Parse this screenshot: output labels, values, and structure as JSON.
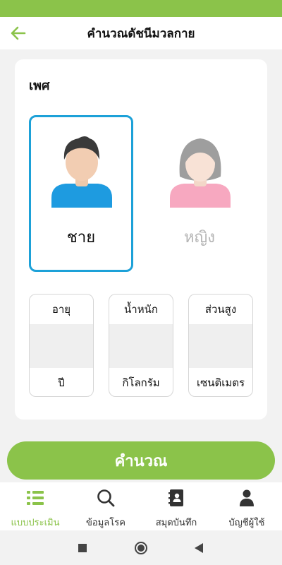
{
  "app_bar": {
    "title": "คำนวณดัชนีมวลกาย",
    "back_icon": "arrow-back-icon"
  },
  "colors": {
    "accent": "#8bc34a",
    "selected_border": "#1da1d8",
    "male_shirt": "#1e9be0",
    "female_shirt": "#f7a8c0",
    "inactive_text": "#b5b5b5"
  },
  "gender": {
    "label": "เพศ",
    "selected": "male",
    "options": [
      {
        "id": "male",
        "label": "ชาย",
        "icon": "male-avatar-icon"
      },
      {
        "id": "female",
        "label": "หญิง",
        "icon": "female-avatar-icon"
      }
    ]
  },
  "measurements": {
    "age": {
      "label": "อายุ",
      "value": "",
      "unit": "ปี"
    },
    "weight": {
      "label": "น้ำหนัก",
      "value": "",
      "unit": "กิโลกรัม"
    },
    "height": {
      "label": "ส่วนสูง",
      "value": "",
      "unit": "เซนติเมตร"
    }
  },
  "calculate_button": {
    "label": "คำนวณ"
  },
  "bottom_nav": {
    "active": "assessment",
    "items": [
      {
        "id": "assessment",
        "label": "แบบประเมิน",
        "icon": "list-icon"
      },
      {
        "id": "disease",
        "label": "ข้อมูลโรค",
        "icon": "search-icon"
      },
      {
        "id": "notebook",
        "label": "สมุดบันทึก",
        "icon": "contact-book-icon"
      },
      {
        "id": "account",
        "label": "บัญชีผู้ใช้",
        "icon": "person-icon"
      }
    ]
  },
  "system_nav": {
    "icons": [
      "recents-square-icon",
      "home-circle-icon",
      "back-triangle-icon"
    ]
  }
}
